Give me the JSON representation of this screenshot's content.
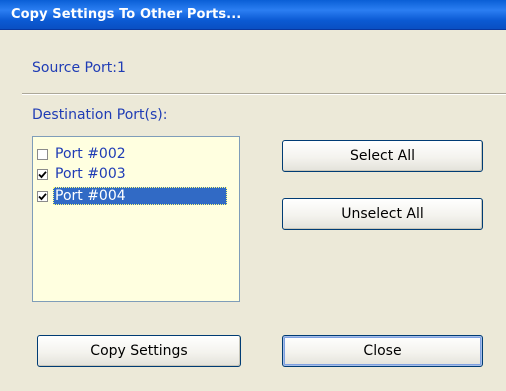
{
  "window": {
    "title": "Copy Settings To Other Ports..."
  },
  "source": {
    "label": "Source Port:1"
  },
  "destination": {
    "label": "Destination Port(s):",
    "ports": [
      {
        "label": "Port #002",
        "checked": false,
        "selected": false
      },
      {
        "label": "Port #003",
        "checked": true,
        "selected": false
      },
      {
        "label": "Port #004",
        "checked": true,
        "selected": true
      }
    ]
  },
  "buttons": {
    "select_all": "Select All",
    "unselect_all": "Unselect All",
    "copy_settings": "Copy Settings",
    "close": "Close"
  },
  "colors": {
    "title_bar": "#0a5fd6",
    "label_text": "#1f3cb5",
    "list_background": "#ffffe0",
    "selection": "#316ac5",
    "dialog_background": "#ece9d8"
  }
}
